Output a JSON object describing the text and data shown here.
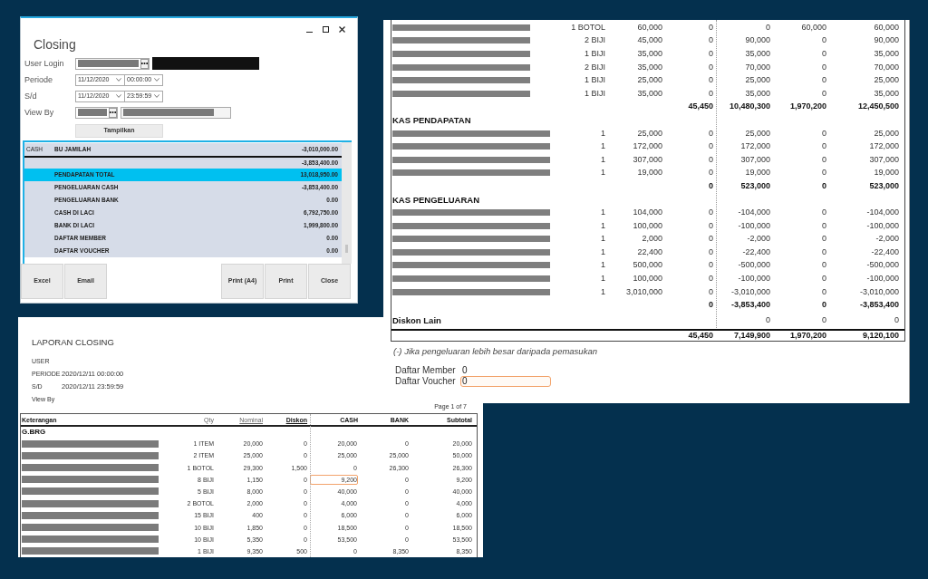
{
  "closing_window": {
    "title": "Closing",
    "fields": [
      {
        "label": "User Login",
        "kind": "account"
      },
      {
        "label": "Periode",
        "kind": "datetime",
        "date": "11/12/2020",
        "time": "00:00:00"
      },
      {
        "label": "S/d",
        "kind": "datetime",
        "date": "11/12/2020",
        "time": "23:59:59"
      },
      {
        "label": "View By",
        "kind": "lookup"
      }
    ],
    "show_button": "Tampilkan",
    "grid_rows": [
      {
        "kind": "line",
        "selected": false,
        "column_1": "CASH",
        "column_2": "BU JAMILAH",
        "column_3": "-3,010,000.00"
      },
      {
        "kind": "total",
        "selected": false,
        "column_3": "-3,853,400.00"
      },
      {
        "kind": "line",
        "selected": true,
        "column_2": "PENDAPATAN TOTAL",
        "column_3": "13,018,950.00"
      },
      {
        "kind": "line",
        "selected": false,
        "column_2": "PENGELUARAN CASH",
        "column_3": "-3,853,400.00"
      },
      {
        "kind": "line",
        "selected": false,
        "column_2": "PENGELUARAN BANK",
        "column_3": "0.00"
      },
      {
        "kind": "line",
        "selected": false,
        "column_2": "CASH DI LACI",
        "column_3": "6,792,750.00"
      },
      {
        "kind": "line",
        "selected": false,
        "column_2": "BANK DI LACI",
        "column_3": "1,999,800.00"
      },
      {
        "kind": "line",
        "selected": false,
        "column_2": "DAFTAR MEMBER",
        "column_3": "0.00"
      },
      {
        "kind": "line",
        "selected": false,
        "column_2": "DAFTAR VOUCHER",
        "column_3": "0.00"
      }
    ],
    "left_buttons": [
      "Excel",
      "Email"
    ],
    "right_buttons": [
      "Print (A4)",
      "Print",
      "Close"
    ]
  },
  "report_page": {
    "sections": [
      {
        "kind": "items",
        "rows": [
          {
            "qty": "1 BOTOL",
            "nominal": "60,000",
            "diskon": "0",
            "cash": "0",
            "bank": "60,000",
            "subtotal": "60,000"
          },
          {
            "qty": "2 BIJI",
            "nominal": "45,000",
            "diskon": "0",
            "cash": "90,000",
            "bank": "0",
            "subtotal": "90,000"
          },
          {
            "qty": "1 BIJI",
            "nominal": "35,000",
            "diskon": "0",
            "cash": "35,000",
            "bank": "0",
            "subtotal": "35,000"
          },
          {
            "qty": "2 BIJI",
            "nominal": "35,000",
            "diskon": "0",
            "cash": "70,000",
            "bank": "0",
            "subtotal": "70,000"
          },
          {
            "qty": "1 BIJI",
            "nominal": "25,000",
            "diskon": "0",
            "cash": "25,000",
            "bank": "0",
            "subtotal": "25,000"
          },
          {
            "qty": "1 BIJI",
            "nominal": "35,000",
            "diskon": "0",
            "cash": "35,000",
            "bank": "0",
            "subtotal": "35,000"
          }
        ],
        "total": {
          "diskon": "45,450",
          "cash": "10,480,300",
          "bank": "1,970,200",
          "subtotal": "12,450,500"
        }
      },
      {
        "kind": "cash",
        "heading": "KAS PENDAPATAN",
        "rows": [
          {
            "qty": "1",
            "nominal": "25,000",
            "diskon": "0",
            "cash": "25,000",
            "bank": "0",
            "subtotal": "25,000"
          },
          {
            "qty": "1",
            "nominal": "172,000",
            "diskon": "0",
            "cash": "172,000",
            "bank": "0",
            "subtotal": "172,000"
          },
          {
            "qty": "1",
            "nominal": "307,000",
            "diskon": "0",
            "cash": "307,000",
            "bank": "0",
            "subtotal": "307,000"
          },
          {
            "qty": "1",
            "nominal": "19,000",
            "diskon": "0",
            "cash": "19,000",
            "bank": "0",
            "subtotal": "19,000"
          }
        ],
        "total": {
          "diskon": "0",
          "cash": "523,000",
          "bank": "0",
          "subtotal": "523,000"
        }
      },
      {
        "kind": "cash",
        "heading": "KAS PENGELUARAN",
        "rows": [
          {
            "qty": "1",
            "nominal": "104,000",
            "diskon": "0",
            "cash": "-104,000",
            "bank": "0",
            "subtotal": "-104,000"
          },
          {
            "qty": "1",
            "nominal": "100,000",
            "diskon": "0",
            "cash": "-100,000",
            "bank": "0",
            "subtotal": "-100,000"
          },
          {
            "qty": "1",
            "nominal": "2,000",
            "diskon": "0",
            "cash": "-2,000",
            "bank": "0",
            "subtotal": "-2,000"
          },
          {
            "qty": "1",
            "nominal": "22,400",
            "diskon": "0",
            "cash": "-22,400",
            "bank": "0",
            "subtotal": "-22,400"
          },
          {
            "qty": "1",
            "nominal": "500,000",
            "diskon": "0",
            "cash": "-500,000",
            "bank": "0",
            "subtotal": "-500,000"
          },
          {
            "qty": "1",
            "nominal": "100,000",
            "diskon": "0",
            "cash": "-100,000",
            "bank": "0",
            "subtotal": "-100,000"
          },
          {
            "qty": "1",
            "nominal": "3,010,000",
            "diskon": "0",
            "cash": "-3,010,000",
            "bank": "0",
            "subtotal": "-3,010,000"
          }
        ],
        "total": {
          "diskon": "0",
          "cash": "-3,853,400",
          "bank": "0",
          "subtotal": "-3,853,400"
        }
      },
      {
        "kind": "line",
        "label": "Diskon Lain",
        "cash": "0",
        "bank": "0",
        "subtotal": "0"
      }
    ],
    "grand_total": {
      "diskon": "45,450",
      "cash": "7,149,900",
      "bank": "1,970,200",
      "subtotal": "9,120,100"
    },
    "note": "(-) Jika pengeluaran lebih besar daripada pemasukan",
    "counts": [
      {
        "label": "Daftar Member",
        "value": "0",
        "selected": false
      },
      {
        "label": "Daftar Voucher",
        "value": "0",
        "selected": true
      }
    ]
  },
  "report_preview": {
    "title": "LAPORAN CLOSING",
    "meta": [
      {
        "label": "USER"
      },
      {
        "label": "PERIODE",
        "value": "2020/12/11 00:00:00"
      },
      {
        "label": "S/D",
        "value": "2020/12/11 23:59:59"
      },
      {
        "label": "View By"
      }
    ],
    "page_label": "Page 1 of 7",
    "columns": [
      {
        "label": "Keterangan",
        "bold": true,
        "underlined": false
      },
      {
        "label": "Qty",
        "bold": false,
        "underlined": false
      },
      {
        "label": "Nominal",
        "bold": false,
        "underlined": true
      },
      {
        "label": "Diskon",
        "bold": true,
        "underlined": true
      },
      {
        "label": "CASH",
        "bold": true,
        "underlined": false
      },
      {
        "label": "BANK",
        "bold": true,
        "underlined": false
      },
      {
        "label": "Subtotal",
        "bold": true,
        "underlined": false
      }
    ],
    "group": "G.BRG",
    "rows": [
      {
        "qty": "1 ITEM",
        "nominal": "20,000",
        "diskon": "0",
        "cash": "20,000",
        "bank": "0",
        "subtotal": "20,000",
        "selected": false
      },
      {
        "qty": "2 ITEM",
        "nominal": "25,000",
        "diskon": "0",
        "cash": "25,000",
        "bank": "25,000",
        "subtotal": "50,000",
        "selected": false
      },
      {
        "qty": "1 BOTOL",
        "nominal": "29,300",
        "diskon": "1,500",
        "cash": "0",
        "bank": "26,300",
        "subtotal": "26,300",
        "selected": false
      },
      {
        "qty": "8 BIJI",
        "nominal": "1,150",
        "diskon": "0",
        "cash": "9,200",
        "bank": "0",
        "subtotal": "9,200",
        "selected": true
      },
      {
        "qty": "5 BIJI",
        "nominal": "8,000",
        "diskon": "0",
        "cash": "40,000",
        "bank": "0",
        "subtotal": "40,000",
        "selected": false
      },
      {
        "qty": "2 BOTOL",
        "nominal": "2,000",
        "diskon": "0",
        "cash": "4,000",
        "bank": "0",
        "subtotal": "4,000",
        "selected": false
      },
      {
        "qty": "15 BIJI",
        "nominal": "400",
        "diskon": "0",
        "cash": "6,000",
        "bank": "0",
        "subtotal": "6,000",
        "selected": false
      },
      {
        "qty": "10 BIJI",
        "nominal": "1,850",
        "diskon": "0",
        "cash": "18,500",
        "bank": "0",
        "subtotal": "18,500",
        "selected": false
      },
      {
        "qty": "10 BIJI",
        "nominal": "5,350",
        "diskon": "0",
        "cash": "53,500",
        "bank": "0",
        "subtotal": "53,500",
        "selected": false
      },
      {
        "qty": "1 BIJI",
        "nominal": "9,350",
        "diskon": "500",
        "cash": "0",
        "bank": "8,350",
        "subtotal": "8,350",
        "selected": false
      }
    ]
  }
}
